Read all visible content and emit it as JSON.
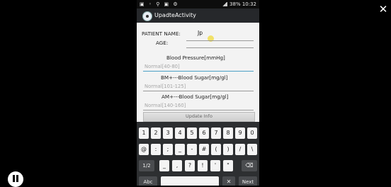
{
  "overlay": {
    "close_glyph": "✕"
  },
  "status_bar": {
    "left_icons": "▣ ◦ ⚲ ▣ ⚙",
    "right_text": "38% 10:32"
  },
  "action_bar": {
    "title": "UpadteActivity"
  },
  "form": {
    "patient_name_label": "PATIENT NAME:",
    "patient_name_value": "Jp",
    "age_label": "AGE:",
    "age_value": "",
    "bp_label": "Blood Pressure[mmHg]",
    "bp_hint": "Normal[40-80]",
    "bm_label": "BM+---Blood Sugar[mg/gl]",
    "bm_hint": "Normal[101-125]",
    "am_label": "AM+---Blood Sugar[mg/gl]",
    "am_hint": "Normal[140-160]",
    "update_button": "Update Info"
  },
  "keyboard": {
    "row1": [
      "1",
      "2",
      "3",
      "4",
      "5",
      "6",
      "7",
      "8",
      "9",
      "0"
    ],
    "row2": [
      "@",
      ":",
      ";",
      "_",
      "-",
      "#",
      "(",
      ")",
      "/",
      "\\"
    ],
    "row3": [
      "1/2",
      "_",
      ",",
      "?",
      "!",
      "'",
      "\"",
      "⌫"
    ],
    "row4": [
      "Abc",
      " ",
      "✕",
      "Next"
    ]
  }
}
